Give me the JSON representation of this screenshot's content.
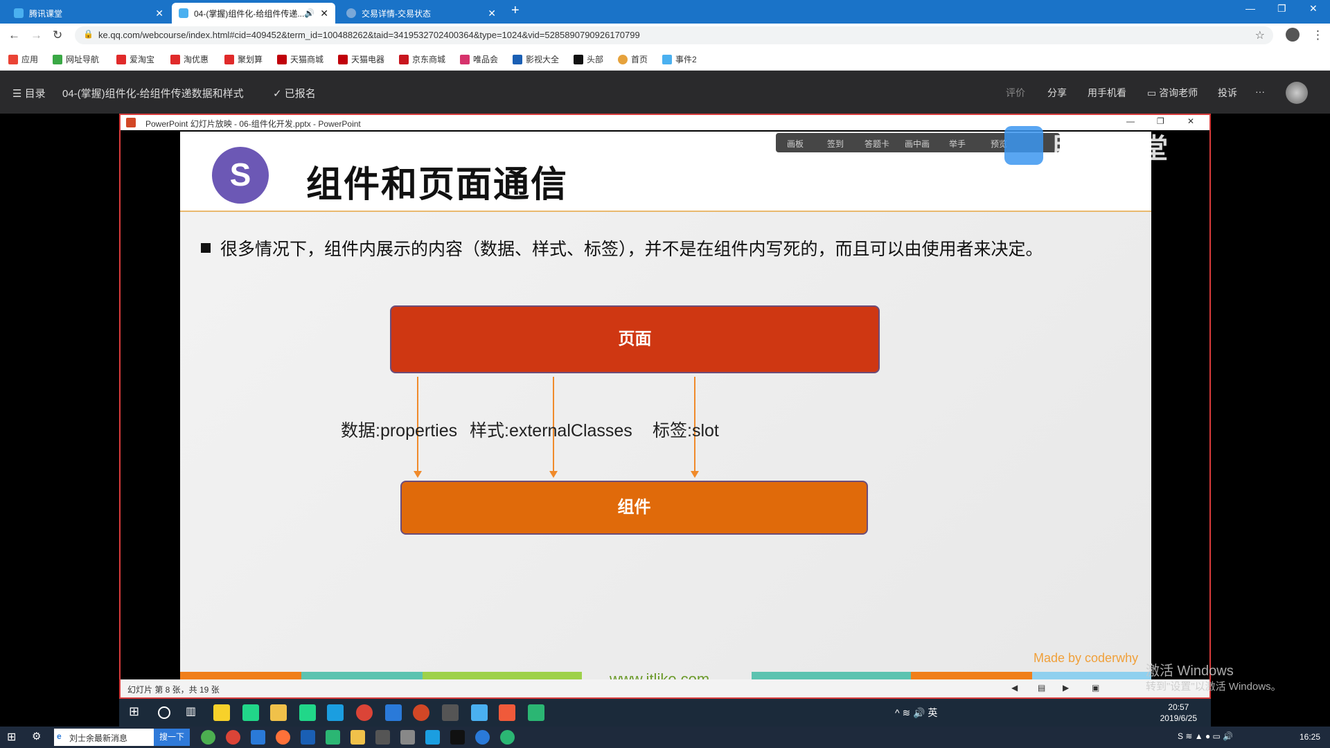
{
  "browser": {
    "tabs": [
      {
        "label": "腾讯课堂",
        "active": false
      },
      {
        "label": "04-(掌握)组件化-给组件传递...",
        "active": true
      },
      {
        "label": "交易详情-交易状态",
        "active": false
      }
    ],
    "url": "ke.qq.com/webcourse/index.html#cid=409452&term_id=100488262&taid=3419532702400364&type=1024&vid=5285890790926170799",
    "bookmarks": [
      "应用",
      "网址导航",
      "爱淘宝",
      "淘优惠",
      "聚划算",
      "天猫商城",
      "天猫电器",
      "京东商城",
      "唯品会",
      "影视大全",
      "头部",
      "首页",
      "事件2"
    ]
  },
  "course": {
    "menu_label": "目录",
    "title": "04-(掌握)组件化-给组件传递数据和样式",
    "enrolled": "已报名",
    "actions": [
      "评价",
      "分享",
      "用手机看",
      "咨询老师",
      "投诉",
      "···"
    ]
  },
  "ppt": {
    "window_title": "PowerPoint 幻灯片放映  -  06-组件化开发.pptx - PowerPoint",
    "status": "幻灯片 第 8 张，共 19 张"
  },
  "slide": {
    "title": "组件和页面通信",
    "bullet": "很多情况下，组件内展示的内容（数据、样式、标签），并不是在组件内写死的，而且可以由使用者来决定。",
    "page_box": "页面",
    "component_box": "组件",
    "labels": [
      "数据:properties",
      "样式:externalClasses",
      "标签:slot"
    ],
    "footer_url": "www.itlike.com",
    "made_by": "Made by coderwhy"
  },
  "overlay": {
    "tools": [
      "画板",
      "签到",
      "答题卡",
      "画中画",
      "举手",
      "预览"
    ],
    "watermark": "腾讯课堂",
    "activate_line1": "激活 Windows",
    "activate_line2": "转到\"设置\"以激活 Windows。"
  },
  "inner_taskbar": {
    "time": "20:57",
    "date": "2019/6/25"
  },
  "host_taskbar": {
    "search_placeholder": "刘士余最新消息",
    "search_button": "搜一下",
    "time": "16:25"
  },
  "colors": {
    "accent_blue": "#1a73c8",
    "page_box": "#cf3712",
    "component_box": "#e06a0a",
    "arrow": "#f08a2a"
  }
}
